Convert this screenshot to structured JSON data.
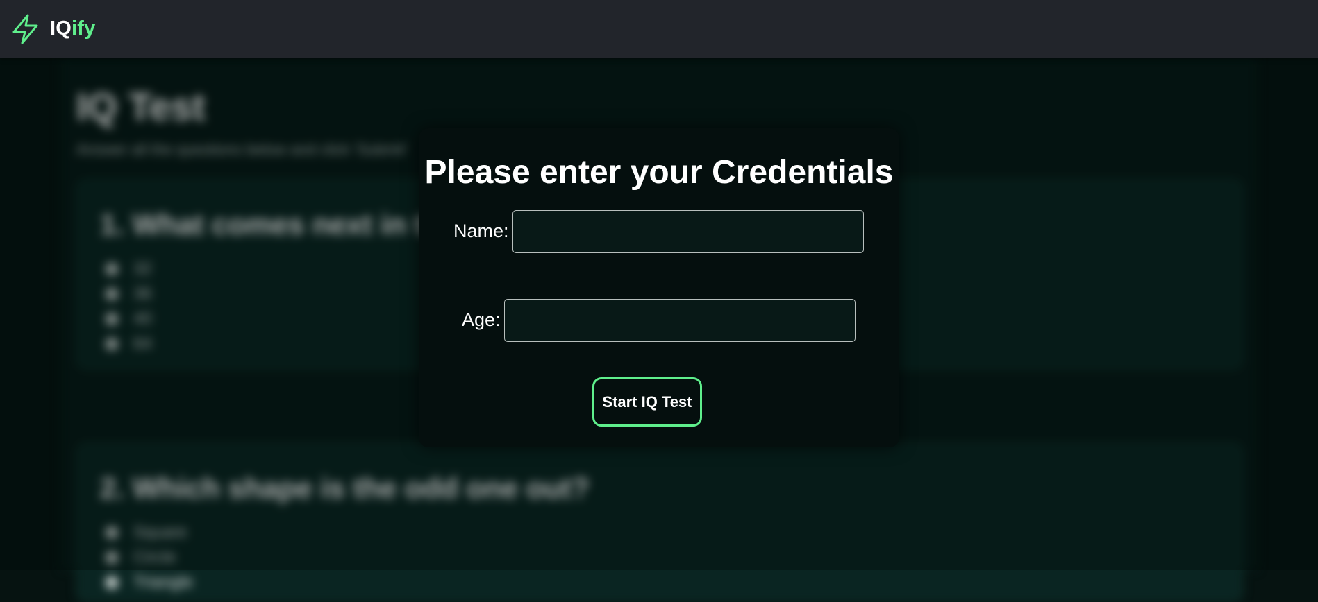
{
  "navbar": {
    "brand_part1": "IQ",
    "brand_part2": "ify",
    "brand_icon": "lightning-bolt-icon",
    "accent_color": "#5fef8c"
  },
  "background_page": {
    "title": "IQ Test",
    "subtitle": "Answer all the questions below and click 'Submit'",
    "questions": [
      {
        "question": "1. What comes next in the sequence?",
        "options": [
          "32",
          "36",
          "40",
          "64"
        ]
      },
      {
        "question": "2. Which shape is the odd one out?",
        "options": [
          "Square",
          "Circle",
          "Triangle"
        ]
      }
    ]
  },
  "modal": {
    "title": "Please enter your Credentials",
    "name_label": "Name:",
    "name_value": "",
    "age_label": "Age:",
    "age_value": "",
    "start_button": "Start IQ Test"
  }
}
